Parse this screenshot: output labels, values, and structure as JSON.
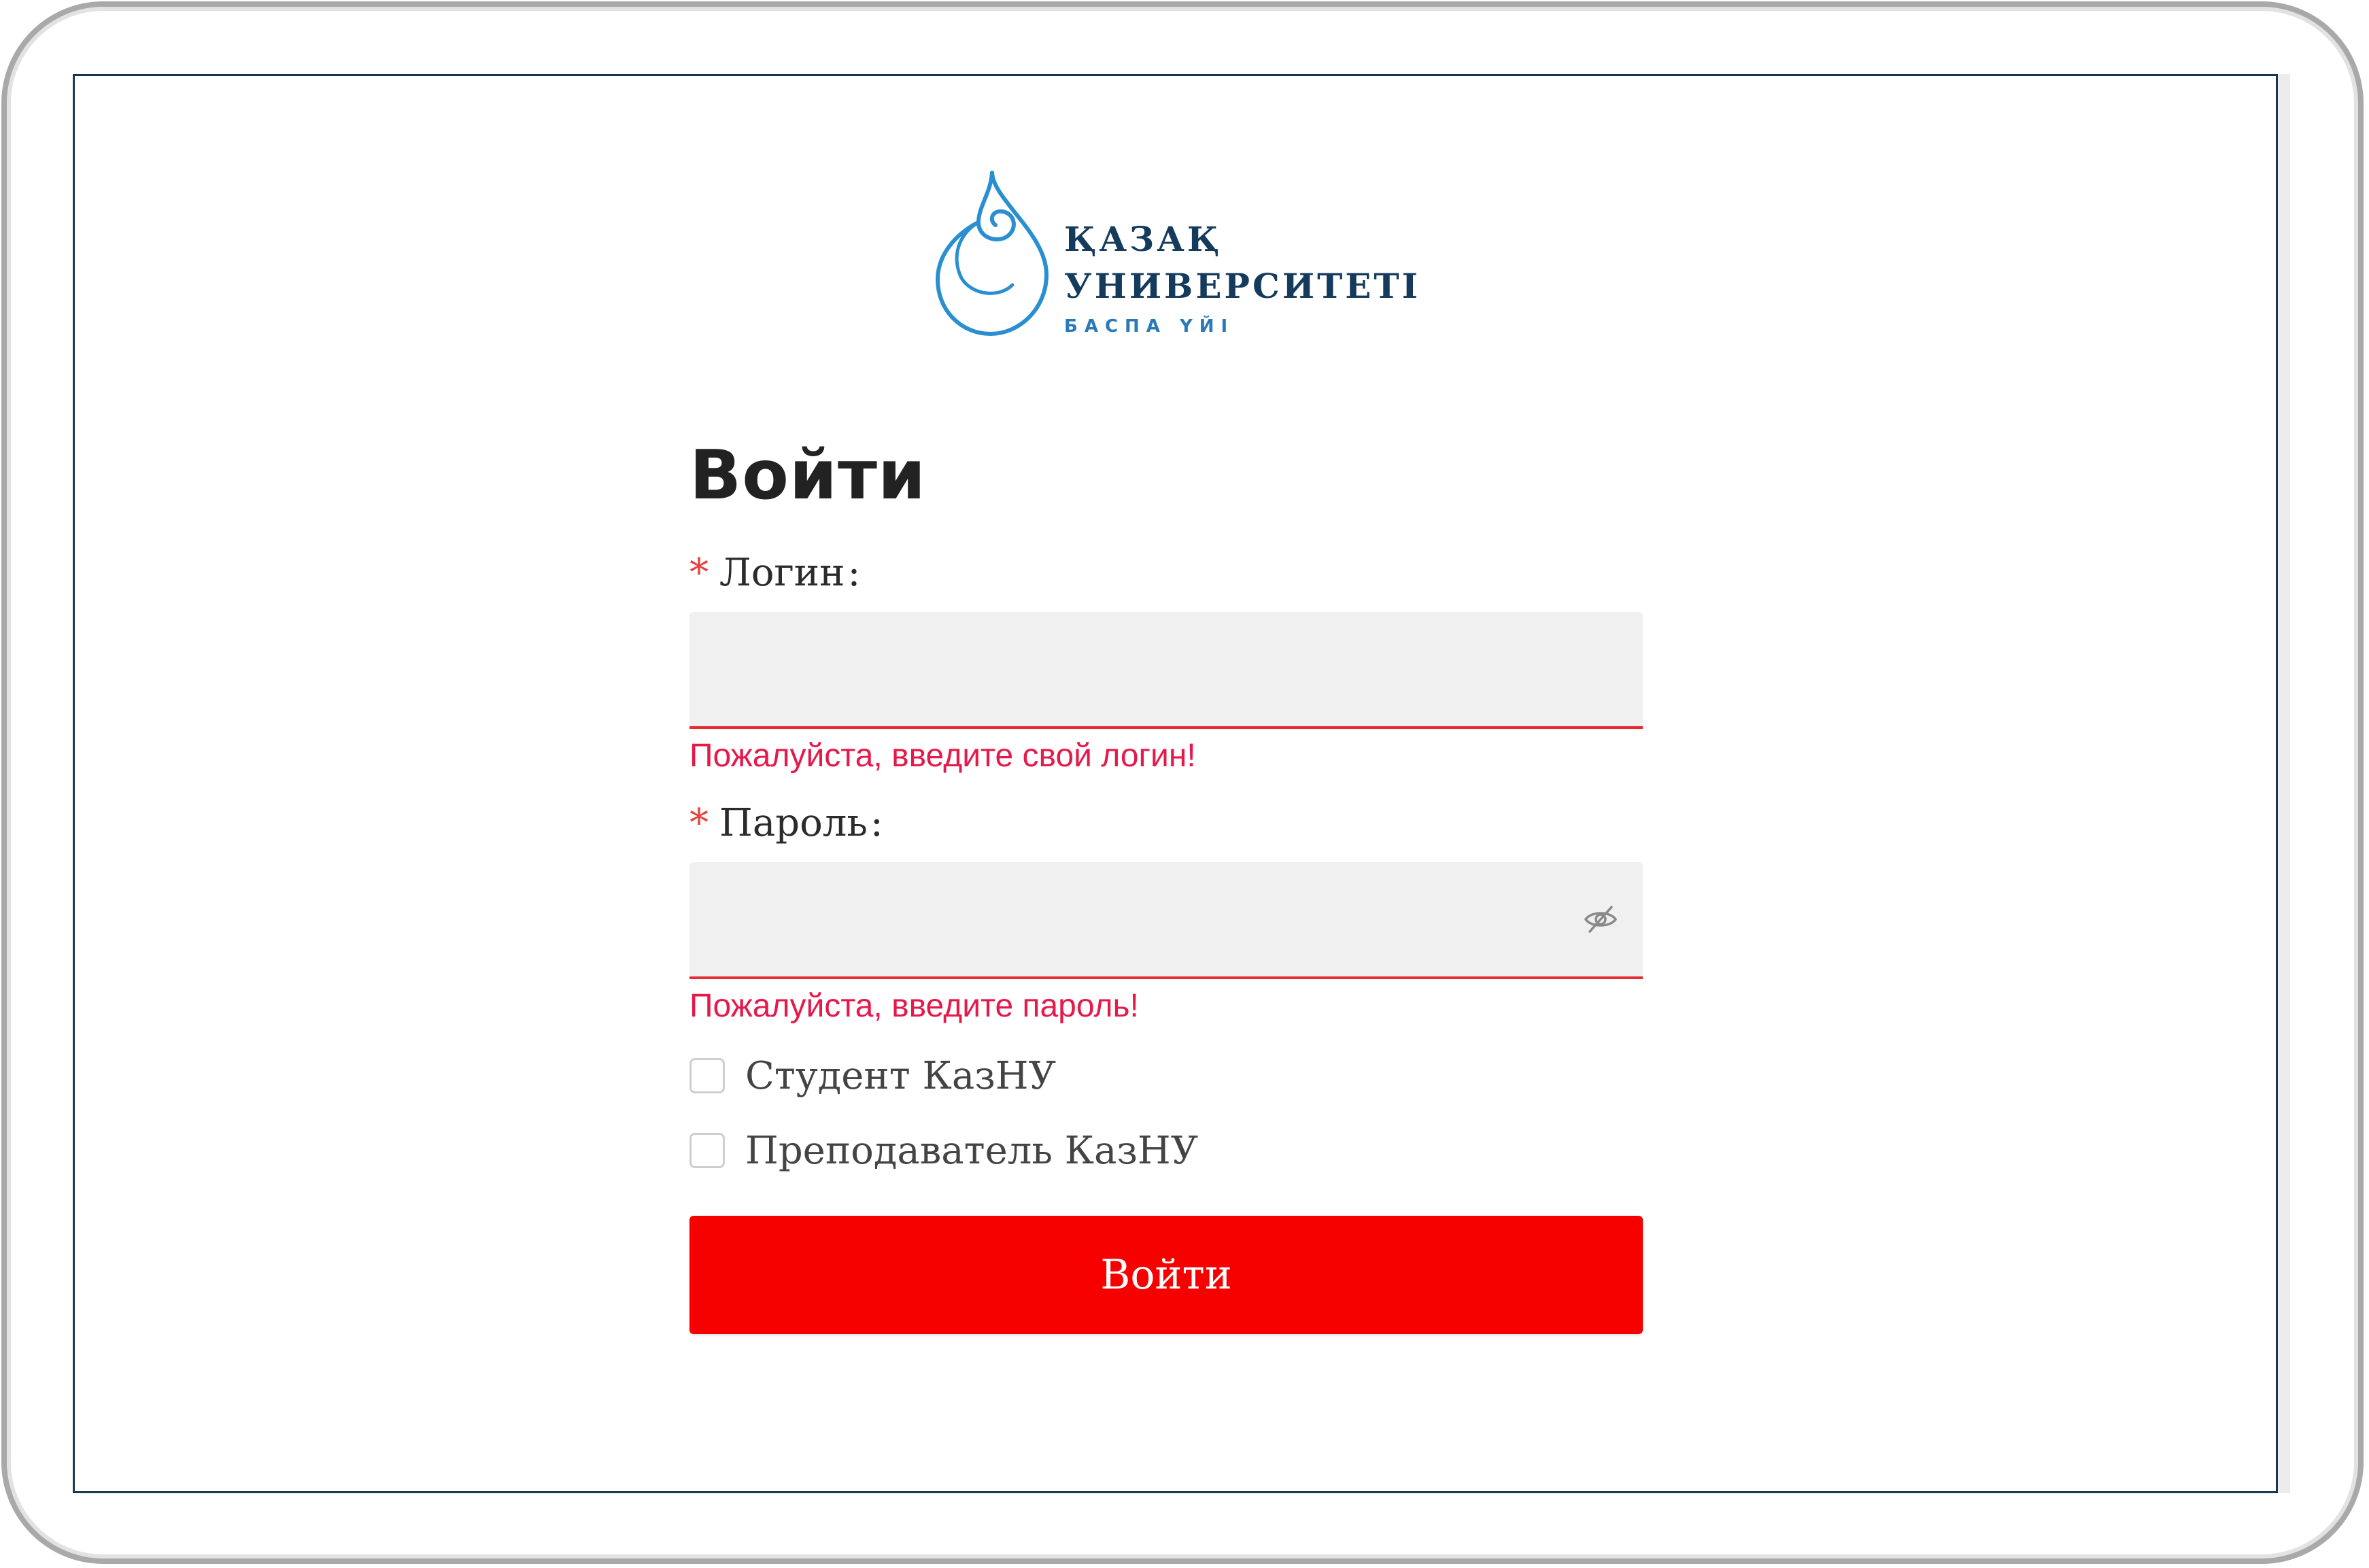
{
  "logo": {
    "line1": "ҚАЗАҚ",
    "line2": "УНИВЕРСИТЕТІ",
    "line3": "БАСПА ҮЙІ",
    "color_dark": "#143a5c",
    "color_accent": "#2a79b8"
  },
  "form": {
    "title": "Войти",
    "login": {
      "required_mark": "*",
      "label": "Логин",
      "colon": ":",
      "value": "",
      "error": "Пожалуйста, введите свой логин!"
    },
    "password": {
      "required_mark": "*",
      "label": "Пароль",
      "colon": ":",
      "value": "",
      "toggle_icon": "eye-invisible-icon",
      "error": "Пожалуйста, введите пароль!"
    },
    "checkboxes": [
      {
        "label": "Студент КазНУ",
        "checked": false
      },
      {
        "label": "Преподаватель КазНУ",
        "checked": false
      }
    ],
    "submit_label": "Войти"
  },
  "colors": {
    "error": "#e6194b",
    "submit_background": "#f60000",
    "field_background": "#f0f0f0",
    "field_underline": "#e82b33"
  }
}
